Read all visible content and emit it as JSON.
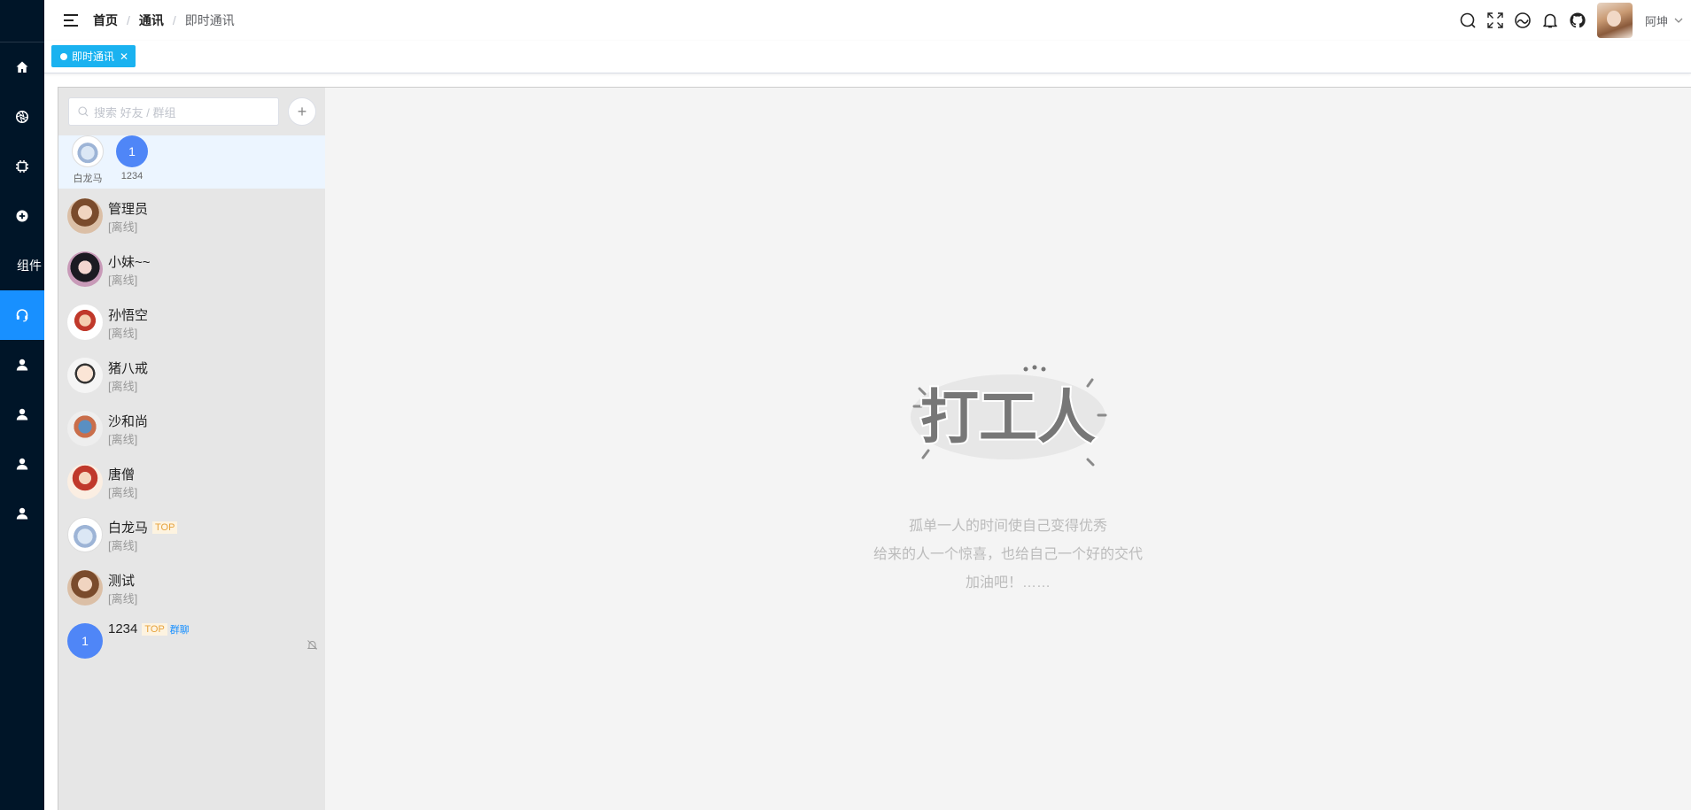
{
  "sidebar": {
    "items": [
      {
        "icon": "home-icon"
      },
      {
        "icon": "aperture-icon"
      },
      {
        "icon": "chip-icon"
      },
      {
        "icon": "plus-circle-icon"
      },
      {
        "icon": "",
        "label": "组件"
      },
      {
        "icon": "headset-icon",
        "active": true
      },
      {
        "icon": "user-icon"
      },
      {
        "icon": "user-icon"
      },
      {
        "icon": "user-icon"
      },
      {
        "icon": "user-icon"
      }
    ]
  },
  "header": {
    "breadcrumb": [
      "首页",
      "通讯",
      "即时通讯"
    ],
    "username": "阿坤",
    "icons": [
      "search-icon",
      "fullscreen-icon",
      "theme-icon",
      "bell-icon",
      "github-icon"
    ]
  },
  "tags": {
    "active": "即时通讯"
  },
  "chat": {
    "search_placeholder": "搜索 好友 / 群组",
    "add_label": "+",
    "top": [
      {
        "label": "白龙马",
        "avatar": "horse"
      },
      {
        "label": "1234",
        "avatar_text": "1"
      }
    ],
    "conversations": [
      {
        "name": "管理员",
        "status": "[离线]",
        "avatar": "admin"
      },
      {
        "name": "小妹~~",
        "status": "[离线]",
        "avatar": "mei"
      },
      {
        "name": "孙悟空",
        "status": "[离线]",
        "avatar": "wk"
      },
      {
        "name": "猪八戒",
        "status": "[离线]",
        "avatar": "bj"
      },
      {
        "name": "沙和尚",
        "status": "[离线]",
        "avatar": "sh"
      },
      {
        "name": "唐僧",
        "status": "[离线]",
        "avatar": "ts"
      },
      {
        "name": "白龙马",
        "status": "[离线]",
        "avatar": "horse",
        "top_badge": "TOP"
      },
      {
        "name": "测试",
        "status": "[离线]",
        "avatar": "admin"
      },
      {
        "name": "1234",
        "avatar_text": "1",
        "top_badge": "TOP",
        "group_badge": "群聊",
        "muted": true
      }
    ],
    "empty": {
      "logo_text": "打工人",
      "lines": [
        "孤单一人的时间使自己变得优秀",
        "给来的人一个惊喜，也给自己一个好的交代",
        "加油吧！……"
      ]
    }
  }
}
